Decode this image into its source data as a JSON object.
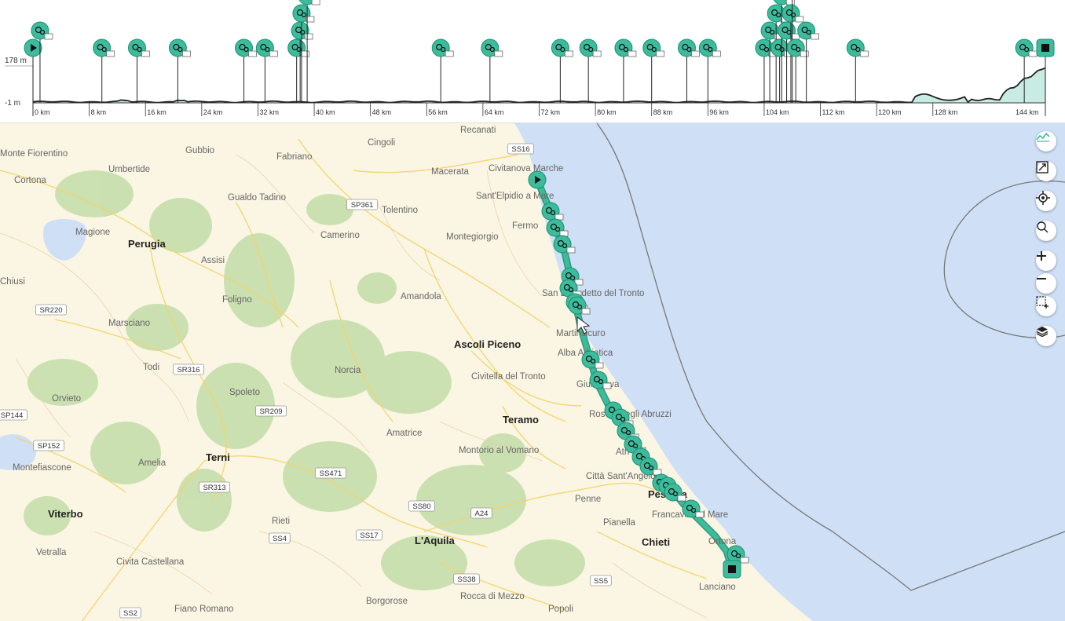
{
  "profile": {
    "y_max_label": "178 m",
    "y_min_label": "-1 m",
    "x_ticks": [
      "0 km",
      "8 km",
      "16 km",
      "24 km",
      "32 km",
      "40 km",
      "48 km",
      "56 km",
      "64 km",
      "72 km",
      "80 km",
      "88 km",
      "96 km",
      "104 km",
      "112 km",
      "120 km",
      "128 km",
      "144 km"
    ],
    "x_tick_values_km": [
      0,
      8,
      16,
      24,
      32,
      40,
      48,
      56,
      64,
      72,
      80,
      88,
      96,
      104,
      112,
      120,
      128,
      144
    ],
    "x_range_km": [
      0,
      144
    ],
    "y_range_m": [
      -1,
      178
    ],
    "fill_color": "#c8ece3",
    "line_color": "#222222",
    "marker_color": "#3cbc9c",
    "markers": [
      {
        "km": 0,
        "icon": "start-icon"
      },
      {
        "km": 1,
        "icon": "poi-icon"
      },
      {
        "km": 9.8,
        "icon": "poi-icon"
      },
      {
        "km": 14.8,
        "icon": "bed-icon"
      },
      {
        "km": 20.6,
        "icon": "poi-icon"
      },
      {
        "km": 30,
        "icon": "poi-icon"
      },
      {
        "km": 33,
        "icon": "poi-icon"
      },
      {
        "km": 37.5,
        "icon": "poi-icon"
      },
      {
        "km": 38,
        "icon": "parking-icon"
      },
      {
        "km": 38.2,
        "icon": "attraction-icon"
      },
      {
        "km": 39,
        "icon": "poi-icon"
      },
      {
        "km": 58,
        "icon": "bus-icon"
      },
      {
        "km": 65,
        "icon": "bus-icon"
      },
      {
        "km": 75,
        "icon": "poi-icon"
      },
      {
        "km": 79,
        "icon": "stream-icon"
      },
      {
        "km": 84,
        "icon": "poi-icon"
      },
      {
        "km": 88,
        "icon": "flag-icon"
      },
      {
        "km": 93,
        "icon": "poi-icon"
      },
      {
        "km": 96,
        "icon": "stream-icon"
      },
      {
        "km": 104,
        "icon": "flag-icon"
      },
      {
        "km": 104.8,
        "icon": "hike-icon"
      },
      {
        "km": 105.7,
        "icon": "poi-icon"
      },
      {
        "km": 106.2,
        "icon": "museum-icon"
      },
      {
        "km": 106.5,
        "icon": "bus-icon"
      },
      {
        "km": 107.2,
        "icon": "poi-icon"
      },
      {
        "km": 107.8,
        "icon": "water-icon"
      },
      {
        "km": 108,
        "icon": "flag-icon"
      },
      {
        "km": 108.5,
        "icon": "poi-icon"
      },
      {
        "km": 110,
        "icon": "poi-icon"
      },
      {
        "km": 117,
        "icon": "poi-icon"
      },
      {
        "km": 141,
        "icon": "poi-icon"
      },
      {
        "km": 144,
        "icon": "finish-icon"
      }
    ]
  },
  "map": {
    "cities": [
      {
        "name": "Perugia",
        "class": "city"
      },
      {
        "name": "Ascoli Piceno",
        "class": "city"
      },
      {
        "name": "Teramo",
        "class": "city"
      },
      {
        "name": "Terni",
        "class": "city"
      },
      {
        "name": "Viterbo",
        "class": "city"
      },
      {
        "name": "L'Aquila",
        "class": "city"
      },
      {
        "name": "Chieti",
        "class": "city"
      },
      {
        "name": "Pescara",
        "class": "city"
      }
    ],
    "towns": [
      "Recanati",
      "Gubbio",
      "Cingoli",
      "Umbertide",
      "Fabriano",
      "Macerata",
      "Civitanova Marche",
      "Sant'Elpidio a Mare",
      "Gualdo Tadino",
      "Tolentino",
      "Fermo",
      "Montegiorgio",
      "Camerino",
      "Magione",
      "Assisi",
      "Foligno",
      "Amandola",
      "San Benedetto del Tronto",
      "Martinsicuro",
      "Alba Adriatica",
      "Giulianova",
      "Marsciano",
      "Norcia",
      "Civitella del Tronto",
      "Roseto degli Abruzzi",
      "Todi",
      "Spoleto",
      "Orvieto",
      "Amatrice",
      "Montorio al Vomano",
      "Atri",
      "Città Sant'Angelo",
      "Amelia",
      "Penne",
      "Montefiascone",
      "Rieti",
      "Pianella",
      "Francavilla al Mare",
      "Vetralla",
      "Civita Castellana",
      "Ortona",
      "Lanciano",
      "Fiano Romano",
      "Borgorose",
      "Rocca di Mezzo",
      "Popoli",
      "Cortona",
      "Chiusi",
      "Monte Fiorentino"
    ],
    "roads": [
      "SS16",
      "SP361",
      "SR220",
      "SR316",
      "SP144",
      "SR209",
      "SP152",
      "SS471",
      "SR313",
      "SS80",
      "A24",
      "SS4",
      "SS17",
      "SS38",
      "SS5",
      "SS2"
    ],
    "route_color": "#3cbc9c",
    "sea_color": "#cfdff5",
    "land_color": "#fbf6e3"
  },
  "controls": [
    {
      "name": "elevation-profile-button",
      "icon": "elevation-icon"
    },
    {
      "name": "fullscreen-button",
      "icon": "expand-icon"
    },
    {
      "name": "locate-button",
      "icon": "locate-icon"
    },
    {
      "name": "search-button",
      "icon": "search-icon"
    },
    {
      "name": "zoom-in-button",
      "icon": "plus-icon"
    },
    {
      "name": "zoom-out-button",
      "icon": "minus-icon"
    },
    {
      "name": "box-zoom-button",
      "icon": "box-select-icon"
    },
    {
      "name": "layers-button",
      "icon": "layers-icon"
    }
  ]
}
